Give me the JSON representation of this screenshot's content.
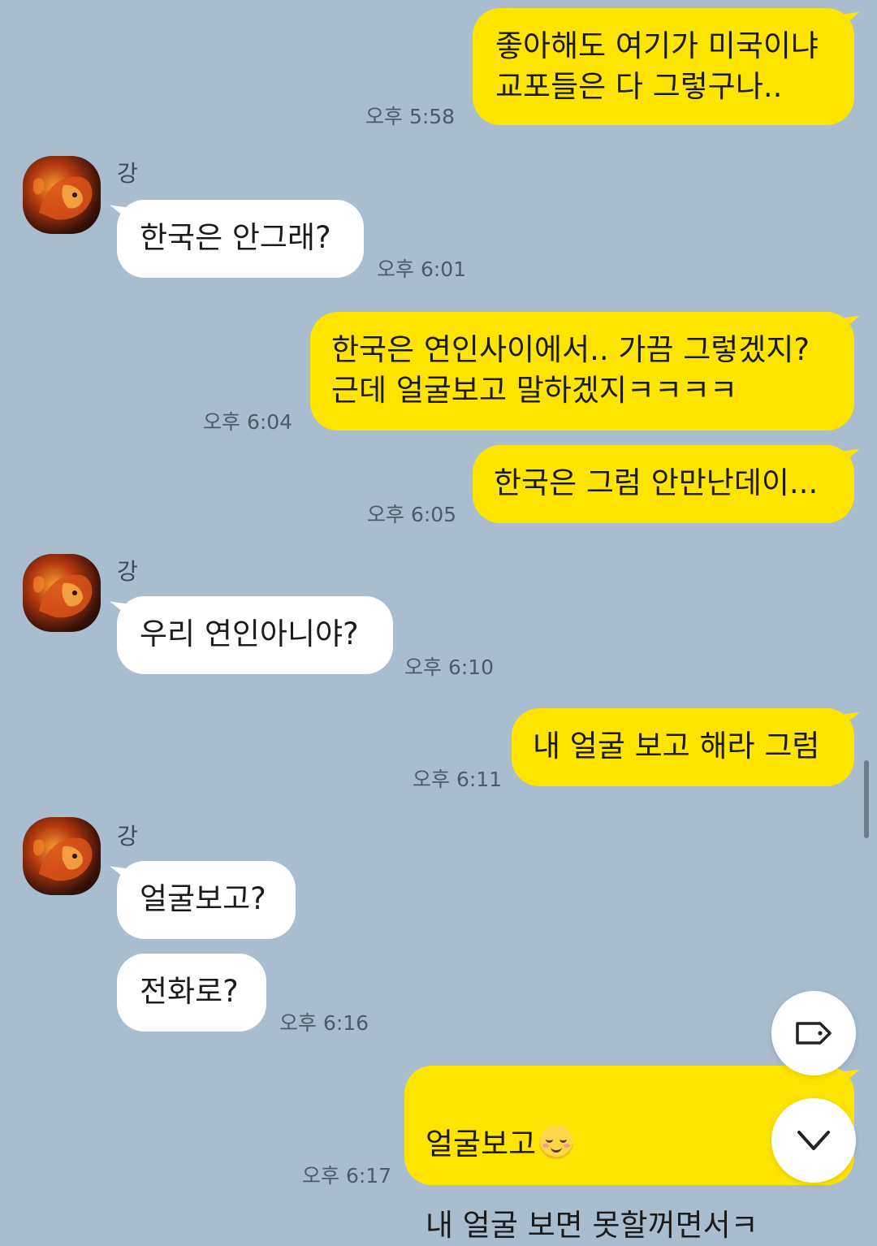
{
  "sender_name": "강",
  "messages": [
    {
      "from": "me",
      "text": "좋아해도 여기가 미국이냐\n교포들은 다 그렇구나..",
      "time": "오후 5:58"
    },
    {
      "from": "them",
      "text": "한국은 안그래?",
      "time": "오후 6:01"
    },
    {
      "from": "me",
      "text": "한국은 연인사이에서.. 가끔 그렇겠지?\n근데 얼굴보고 말하겠지ㅋㅋㅋㅋ",
      "time": "오후 6:04"
    },
    {
      "from": "me",
      "text": "한국은 그럼 안만난데이...",
      "time": "오후 6:05"
    },
    {
      "from": "them",
      "text": "우리 연인아니야?",
      "time": "오후 6:10"
    },
    {
      "from": "me",
      "text": "내 얼굴 보고 해라 그럼",
      "time": "오후 6:11"
    },
    {
      "from": "them",
      "text": "얼굴보고?",
      "time": ""
    },
    {
      "from": "them",
      "text": "전화로?",
      "time": "오후 6:16"
    },
    {
      "from": "me",
      "text_line1": "얼굴보고",
      "emoji": "relieved-face",
      "text_line2": "내 얼굴 보면 못할꺼면서ㅋ",
      "time": "오후 6:17"
    }
  ],
  "controls": {
    "tag_icon": "tag-icon",
    "scroll_down_icon": "chevron-down-icon"
  },
  "colors": {
    "background": "#a9bdcf",
    "my_bubble": "#fee500",
    "their_bubble": "#ffffff"
  }
}
